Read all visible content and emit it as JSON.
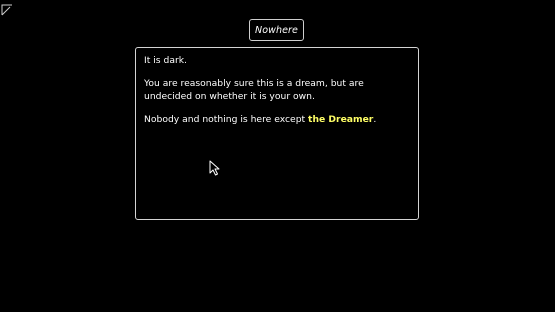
{
  "location": {
    "title": "Nowhere"
  },
  "narrative": {
    "line1": "It is dark.",
    "line2": "You are reasonably sure this is a dream, but are undecided on whether it is your own.",
    "line3_prefix": "Nobody and nothing is here except ",
    "line3_highlight": "the Dreamer",
    "line3_suffix": "."
  },
  "icons": {
    "corner": "corner-arrow-icon",
    "cursor": "mouse-pointer-icon"
  },
  "colors": {
    "background": "#000000",
    "text": "#ffffff",
    "highlight": "#ffff66",
    "border": "#d4d4d4"
  }
}
